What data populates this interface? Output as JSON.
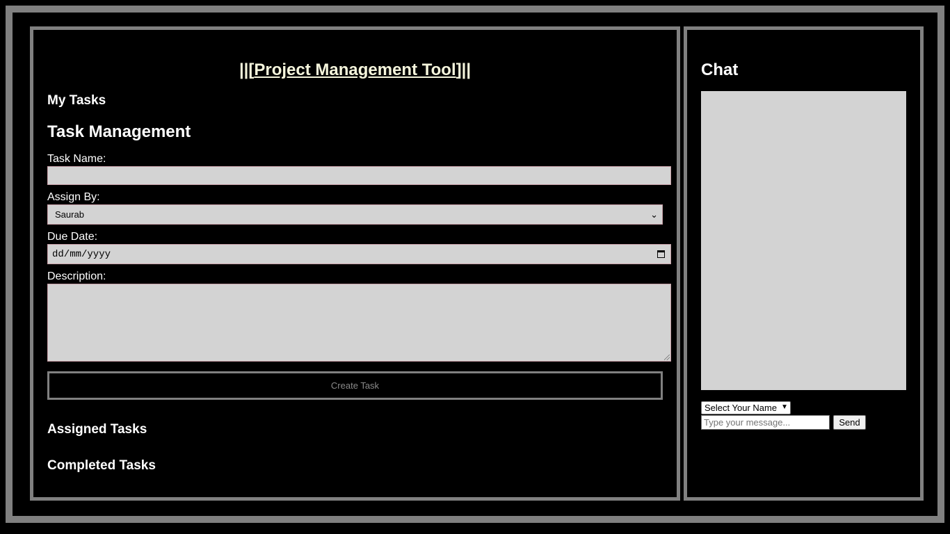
{
  "header": {
    "title_prefix": "||[",
    "title_link": "Project Management Tool",
    "title_suffix": "]||"
  },
  "sections": {
    "my_tasks": "My Tasks",
    "task_management": "Task Management",
    "assigned_tasks": "Assigned Tasks",
    "completed_tasks": "Completed Tasks"
  },
  "form": {
    "task_name_label": "Task Name:",
    "task_name_value": "",
    "assign_by_label": "Assign By:",
    "assign_by_selected": "Saurab",
    "due_date_label": "Due Date:",
    "due_date_placeholder": "dd/mm/yyyy",
    "description_label": "Description:",
    "description_value": "",
    "create_button": "Create Task"
  },
  "chat": {
    "title": "Chat",
    "name_select_selected": "Select Your Name",
    "message_placeholder": "Type your message...",
    "send_button": "Send"
  },
  "colors": {
    "frame": "#808080",
    "background": "#000000",
    "field": "#d3d3d3",
    "title": "#f5f5dc"
  }
}
